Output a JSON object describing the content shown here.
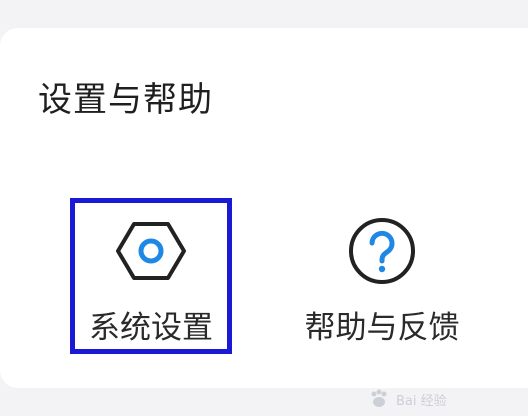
{
  "section": {
    "title": "设置与帮助"
  },
  "items": [
    {
      "label": "系统设置",
      "icon": "hex-nut-settings-icon",
      "accent": "#1e88e5"
    },
    {
      "label": "帮助与反馈",
      "icon": "question-circle-icon",
      "accent": "#1e88e5"
    }
  ],
  "highlight_color": "#1a1ad6",
  "watermark": {
    "text": "Bai 经验"
  }
}
